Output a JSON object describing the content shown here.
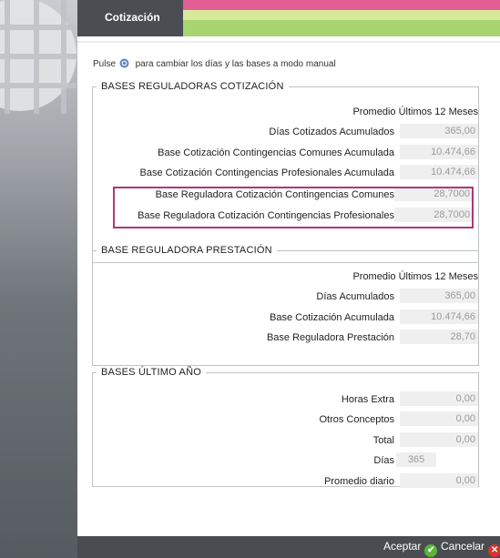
{
  "tab": {
    "title": "Cotización"
  },
  "hint": {
    "before": "Pulse",
    "after": "para cambiar los días y las bases a modo manual"
  },
  "cotizacion": {
    "legend": "BASES REGULADORAS COTIZACIÓN",
    "header": "Promedio Últimos 12 Meses",
    "rows": [
      {
        "label": "Días Cotizados Acumulados",
        "value": "365,00"
      },
      {
        "label": "Base Cotización Contingencias Comunes Acumulada",
        "value": "10.474,66"
      },
      {
        "label": "Base Cotización Contingencias Profesionales Acumulada",
        "value": "10.474,66"
      },
      {
        "label": "Base Reguladora Cotización Contingencias Comunes",
        "value": "28,7000"
      },
      {
        "label": "Base Reguladora Cotización Contingencias Profesionales",
        "value": "28,7000"
      }
    ]
  },
  "prestacion": {
    "legend": "BASE REGULADORA PRESTACIÓN",
    "header": "Promedio Últimos 12 Meses",
    "rows": [
      {
        "label": "Días Acumulados",
        "value": "365,00"
      },
      {
        "label": "Base Cotización Acumulada",
        "value": "10.474,66"
      },
      {
        "label": "Base Reguladora Prestación",
        "value": "28,70"
      }
    ]
  },
  "ultimo": {
    "legend": "BASES ÚLTIMO AÑO",
    "rows": [
      {
        "label": "Horas Extra",
        "value": "0,00"
      },
      {
        "label": "Otros Conceptos",
        "value": "0,00"
      },
      {
        "label": "Total",
        "value": "0,00"
      },
      {
        "label": "Días",
        "value": "365"
      },
      {
        "label": "Promedio diario",
        "value": "0,00"
      }
    ]
  },
  "footer": {
    "accept": "Aceptar",
    "cancel": "Cancelar",
    "accept_color": "#58b43a",
    "cancel_color": "#d9312b"
  },
  "icons": [
    "gear-icon",
    "check-icon",
    "close-icon"
  ]
}
